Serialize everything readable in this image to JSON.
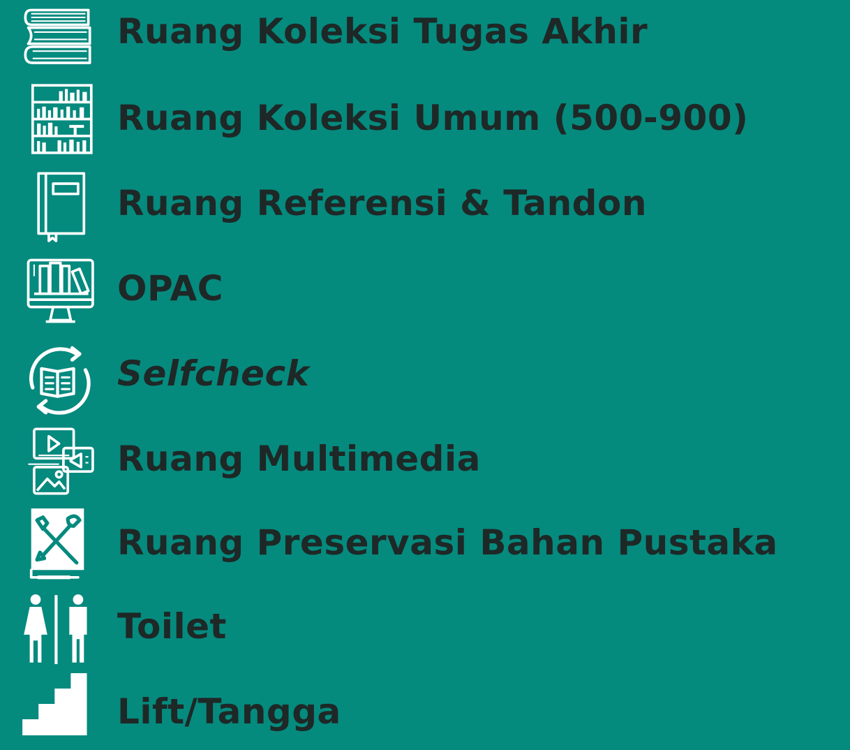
{
  "colors": {
    "background": "#058a7e",
    "text": "#1e2826",
    "icon": "#ffffff"
  },
  "items": [
    {
      "label": "Ruang Koleksi Tugas Akhir",
      "icon": "stacked-books-icon",
      "italic": false
    },
    {
      "label": "Ruang Koleksi Umum (500-900)",
      "icon": "bookshelf-icon",
      "italic": false
    },
    {
      "label": "Ruang Referensi & Tandon",
      "icon": "book-icon",
      "italic": false
    },
    {
      "label": "OPAC",
      "icon": "computer-catalog-icon",
      "italic": false
    },
    {
      "label": "Selfcheck",
      "icon": "book-return-cycle-icon",
      "italic": true
    },
    {
      "label": "Ruang Multimedia",
      "icon": "multimedia-icon",
      "italic": false
    },
    {
      "label": "Ruang Preservasi Bahan Pustaka",
      "icon": "book-repair-tools-icon",
      "italic": false
    },
    {
      "label": "Toilet",
      "icon": "toilet-icon",
      "italic": false
    },
    {
      "label": "Lift/Tangga",
      "icon": "stairs-icon",
      "italic": false
    }
  ]
}
